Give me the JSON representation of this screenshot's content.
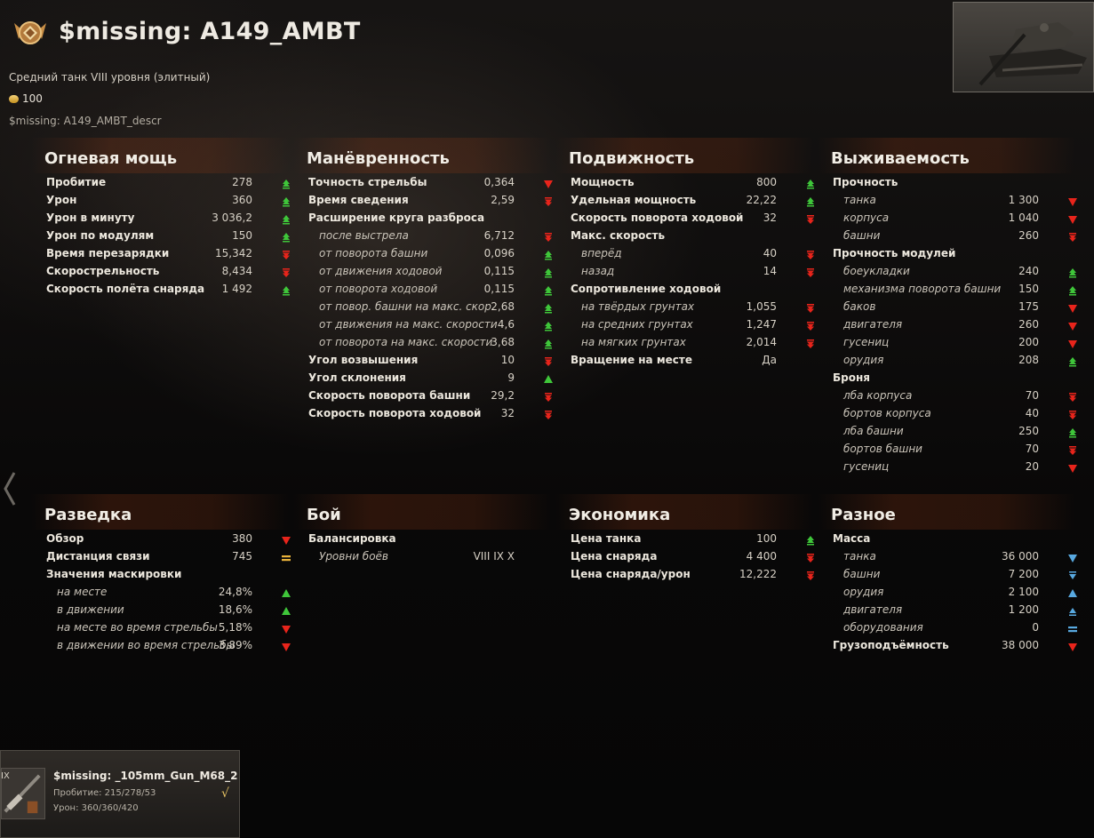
{
  "header": {
    "title": "$missing: A149_AMBT",
    "subtitle": "Средний танк VIII уровня (элитный)",
    "price": "100",
    "description": "$missing: A149_AMBT_descr"
  },
  "colors": {
    "up": "#3fc63a",
    "down": "#e8241b",
    "equal": "#e8b23a",
    "up_blue": "#58a9e0",
    "down_blue": "#58a9e0"
  },
  "sections": {
    "firepower": {
      "title": "Огневая мощь",
      "rows": [
        {
          "label": "Пробитие",
          "value": "278",
          "indicator": "up-small"
        },
        {
          "label": "Урон",
          "value": "360",
          "indicator": "up-small"
        },
        {
          "label": "Урон в минуту",
          "value": "3 036,2",
          "indicator": "up-small"
        },
        {
          "label": "Урон по модулям",
          "value": "150",
          "indicator": "up-small"
        },
        {
          "label": "Время перезарядки",
          "value": "15,342",
          "indicator": "down-small"
        },
        {
          "label": "Скорострельность",
          "value": "8,434",
          "indicator": "down-small"
        },
        {
          "label": "Скорость полёта снаряда",
          "value": "1 492",
          "indicator": "up-small"
        }
      ]
    },
    "maneuver": {
      "title": "Манёвренность",
      "rows": [
        {
          "label": "Точность стрельбы",
          "value": "0,364",
          "indicator": "down"
        },
        {
          "label": "Время сведения",
          "value": "2,59",
          "indicator": "down-small"
        },
        {
          "label": "Расширение круга разброса",
          "value": "",
          "indicator": ""
        },
        {
          "label": "после выстрела",
          "value": "6,712",
          "indicator": "down-small",
          "sub": true
        },
        {
          "label": "от поворота башни",
          "value": "0,096",
          "indicator": "up-small",
          "sub": true
        },
        {
          "label": "от движения ходовой",
          "value": "0,115",
          "indicator": "up-small",
          "sub": true
        },
        {
          "label": "от поворота ходовой",
          "value": "0,115",
          "indicator": "up-small",
          "sub": true
        },
        {
          "label": "от повор. башни на макс. скор.",
          "value": "2,68",
          "indicator": "up-small",
          "sub": true
        },
        {
          "label": "от движения на макс. скорости",
          "value": "4,6",
          "indicator": "up-small",
          "sub": true
        },
        {
          "label": "от поворота на макс. скорости",
          "value": "3,68",
          "indicator": "up-small",
          "sub": true
        },
        {
          "label": "Угол возвышения",
          "value": "10",
          "indicator": "down-small"
        },
        {
          "label": "Угол склонения",
          "value": "9",
          "indicator": "up"
        },
        {
          "label": "Скорость поворота башни",
          "value": "29,2",
          "indicator": "down-small"
        },
        {
          "label": "Скорость поворота ходовой",
          "value": "32",
          "indicator": "down-small"
        }
      ]
    },
    "mobility": {
      "title": "Подвижность",
      "rows": [
        {
          "label": "Мощность",
          "value": "800",
          "indicator": "up-small"
        },
        {
          "label": "Удельная мощность",
          "value": "22,22",
          "indicator": "up-small"
        },
        {
          "label": "Скорость поворота ходовой",
          "value": "32",
          "indicator": "down-small"
        },
        {
          "label": "Макс. скорость",
          "value": "",
          "indicator": ""
        },
        {
          "label": "вперёд",
          "value": "40",
          "indicator": "down-small",
          "sub": true
        },
        {
          "label": "назад",
          "value": "14",
          "indicator": "down-small",
          "sub": true
        },
        {
          "label": "Сопротивление ходовой",
          "value": "",
          "indicator": ""
        },
        {
          "label": "на твёрдых грунтах",
          "value": "1,055",
          "indicator": "down-small",
          "sub": true
        },
        {
          "label": "на средних грунтах",
          "value": "1,247",
          "indicator": "down-small",
          "sub": true
        },
        {
          "label": "на мягких грунтах",
          "value": "2,014",
          "indicator": "down-small",
          "sub": true
        },
        {
          "label": "Вращение на месте",
          "value": "Да",
          "indicator": ""
        }
      ]
    },
    "survivability": {
      "title": "Выживаемость",
      "rows": [
        {
          "label": "Прочность",
          "value": "",
          "indicator": ""
        },
        {
          "label": "танка",
          "value": "1 300",
          "indicator": "down",
          "sub": true
        },
        {
          "label": "корпуса",
          "value": "1 040",
          "indicator": "down",
          "sub": true
        },
        {
          "label": "башни",
          "value": "260",
          "indicator": "down-small",
          "sub": true
        },
        {
          "label": "Прочность модулей",
          "value": "",
          "indicator": ""
        },
        {
          "label": "боеукладки",
          "value": "240",
          "indicator": "up-small",
          "sub": true
        },
        {
          "label": "механизма поворота башни",
          "value": "150",
          "indicator": "up-small",
          "sub": true
        },
        {
          "label": "баков",
          "value": "175",
          "indicator": "down",
          "sub": true
        },
        {
          "label": "двигателя",
          "value": "260",
          "indicator": "down",
          "sub": true
        },
        {
          "label": "гусениц",
          "value": "200",
          "indicator": "down",
          "sub": true
        },
        {
          "label": "орудия",
          "value": "208",
          "indicator": "up-small",
          "sub": true
        },
        {
          "label": "Броня",
          "value": "",
          "indicator": ""
        },
        {
          "label": "лба корпуса",
          "value": "70",
          "indicator": "down-small",
          "sub": true
        },
        {
          "label": "бортов корпуса",
          "value": "40",
          "indicator": "down-small",
          "sub": true
        },
        {
          "label": "лба башни",
          "value": "250",
          "indicator": "up-small",
          "sub": true
        },
        {
          "label": "бортов башни",
          "value": "70",
          "indicator": "down-small",
          "sub": true
        },
        {
          "label": "гусениц",
          "value": "20",
          "indicator": "down",
          "sub": true
        }
      ]
    },
    "recon": {
      "title": "Разведка",
      "rows": [
        {
          "label": "Обзор",
          "value": "380",
          "indicator": "down"
        },
        {
          "label": "Дистанция связи",
          "value": "745",
          "indicator": "equal"
        },
        {
          "label": "Значения маскировки",
          "value": "",
          "indicator": ""
        },
        {
          "label": "на месте",
          "value": "24,8%",
          "indicator": "up",
          "sub": true
        },
        {
          "label": "в движении",
          "value": "18,6%",
          "indicator": "up",
          "sub": true
        },
        {
          "label": "на месте во время стрельбы",
          "value": "5,18%",
          "indicator": "down",
          "sub": true
        },
        {
          "label": "в движении во время стрельбы",
          "value": "3,89%",
          "indicator": "down",
          "sub": true
        }
      ]
    },
    "battle": {
      "title": "Бой",
      "rows": [
        {
          "label": "Балансировка",
          "value": "",
          "indicator": ""
        },
        {
          "label": "Уровни боёв",
          "value": "VIII IX X",
          "indicator": "",
          "sub": true
        }
      ]
    },
    "economy": {
      "title": "Экономика",
      "rows": [
        {
          "label": "Цена танка",
          "value": "100",
          "indicator": "up-small"
        },
        {
          "label": "Цена снаряда",
          "value": "4 400",
          "indicator": "down-small"
        },
        {
          "label": "Цена снаряда/урон",
          "value": "12,222",
          "indicator": "down-small"
        }
      ]
    },
    "misc": {
      "title": "Разное",
      "rows": [
        {
          "label": "Масса",
          "value": "",
          "indicator": ""
        },
        {
          "label": "танка",
          "value": "36 000",
          "indicator": "down-blue",
          "sub": true
        },
        {
          "label": "башни",
          "value": "7 200",
          "indicator": "down-blue-small",
          "sub": true
        },
        {
          "label": "орудия",
          "value": "2 100",
          "indicator": "up-blue",
          "sub": true
        },
        {
          "label": "двигателя",
          "value": "1 200",
          "indicator": "up-blue-small",
          "sub": true
        },
        {
          "label": "оборудования",
          "value": "0",
          "indicator": "equal-blue",
          "sub": true
        },
        {
          "label": "Грузоподъёмность",
          "value": "38 000",
          "indicator": "down"
        }
      ]
    }
  },
  "module_card": {
    "tier": "IX",
    "name": "$missing: _105mm_Gun_M68_2",
    "penetration": "Пробитие: 215/278/53",
    "damage": "Урон: 360/360/420",
    "check": "√"
  }
}
